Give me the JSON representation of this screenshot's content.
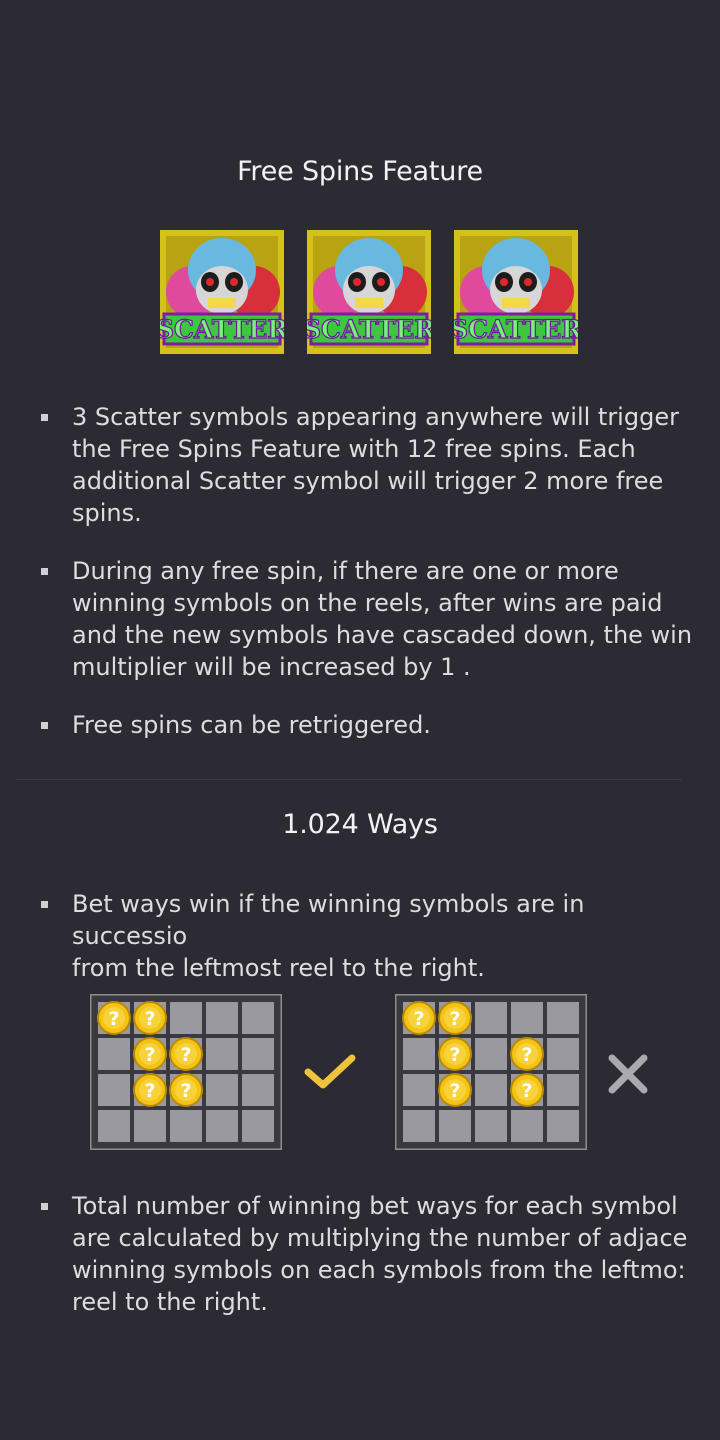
{
  "free_spins": {
    "title": "Free Spins Feature",
    "scatter_symbols": [
      {
        "label": "SCATTER",
        "icon": "scatter-skull-icon"
      },
      {
        "label": "SCATTER",
        "icon": "scatter-skull-icon"
      },
      {
        "label": "SCATTER",
        "icon": "scatter-skull-icon"
      }
    ],
    "bullets": [
      "3 Scatter symbols appearing anywhere will trigger the Free Spins Feature with 12 free spins. Each additional Scatter symbol will trigger 2 more free spins.",
      "During any free spin, if there are one or more winning symbols on the reels, after wins are paid and the new symbols have cascaded down, the win multiplier will be increased by 1 .",
      "Free spins can be retriggered."
    ]
  },
  "ways": {
    "title": "1.024 Ways",
    "bullet_1_lines": [
      "Bet ways win if the winning symbols are in successio",
      "from the leftmost reel to the right."
    ],
    "examples": [
      {
        "result": "valid",
        "icon": "checkmark-icon",
        "coins": [
          [
            0,
            0
          ],
          [
            0,
            1
          ],
          [
            1,
            1
          ],
          [
            1,
            2
          ],
          [
            2,
            1
          ],
          [
            2,
            2
          ]
        ]
      },
      {
        "result": "invalid",
        "icon": "cross-icon",
        "coins": [
          [
            0,
            0
          ],
          [
            0,
            1
          ],
          [
            1,
            1
          ],
          [
            1,
            3
          ],
          [
            2,
            1
          ],
          [
            2,
            3
          ]
        ]
      }
    ],
    "bullet_2_lines": [
      "Total number of winning bet ways for each symbol",
      "are calculated by multiplying the number of adjace",
      "winning symbols on each symbols from the leftmo:",
      "reel to the right."
    ]
  },
  "colors": {
    "background": "#2c2b33",
    "text": "#dcdce2",
    "check": "#f0c33c",
    "cross": "#a9a9b0",
    "coin": "#f3c316",
    "grid_cell": "#9a99a0"
  }
}
